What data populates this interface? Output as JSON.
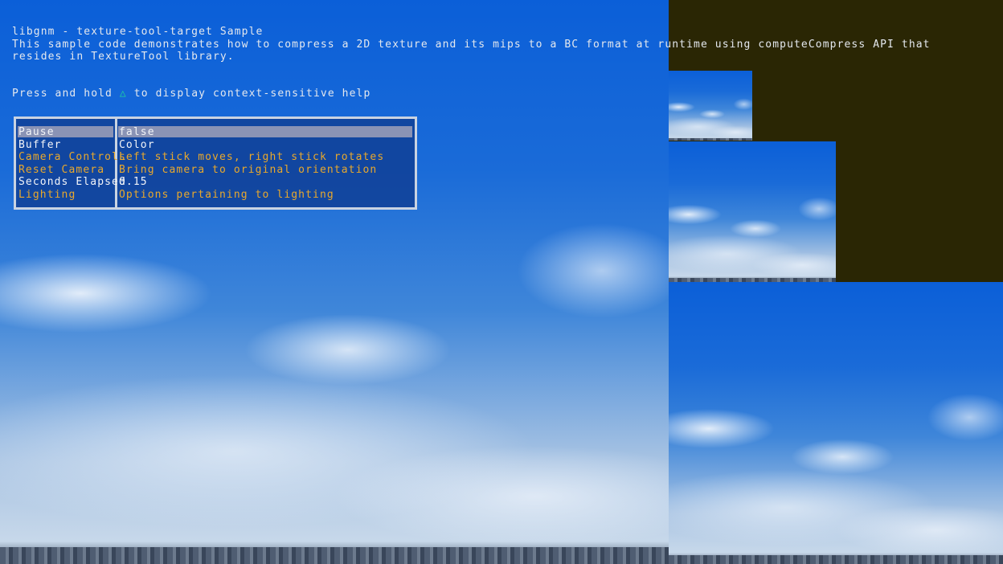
{
  "header": {
    "title": "libgnm - texture-tool-target Sample",
    "description": "This sample code demonstrates how to compress a 2D texture and its mips to a BC format at runtime using computeCompress API that resides in TextureTool library.",
    "help_prefix": "Press and hold",
    "help_icon": "triangle-icon",
    "help_glyph": "△",
    "help_suffix": "to display context-sensitive help"
  },
  "menu": {
    "items": [
      {
        "label": "Pause",
        "value": "false",
        "selected": true,
        "color": "#f2f4f8"
      },
      {
        "label": "Buffer",
        "value": "Color",
        "selected": false,
        "color": "#f2f4f8"
      },
      {
        "label": "Camera Controls",
        "value": "Left stick moves, right stick rotates",
        "selected": false,
        "color": "#e9a82c"
      },
      {
        "label": "Reset Camera",
        "value": "Bring camera to original orientation",
        "selected": false,
        "color": "#e9a82c"
      },
      {
        "label": "Seconds Elapsed",
        "value": "0.15",
        "selected": false,
        "color": "#f2f4f8"
      },
      {
        "label": "Lighting",
        "value": "Options pertaining to lighting",
        "selected": false,
        "color": "#e9a82c"
      }
    ]
  },
  "colors": {
    "background": "#2a2604",
    "accent_orange": "#e9a82c",
    "help_icon": "#1fd3a0"
  }
}
